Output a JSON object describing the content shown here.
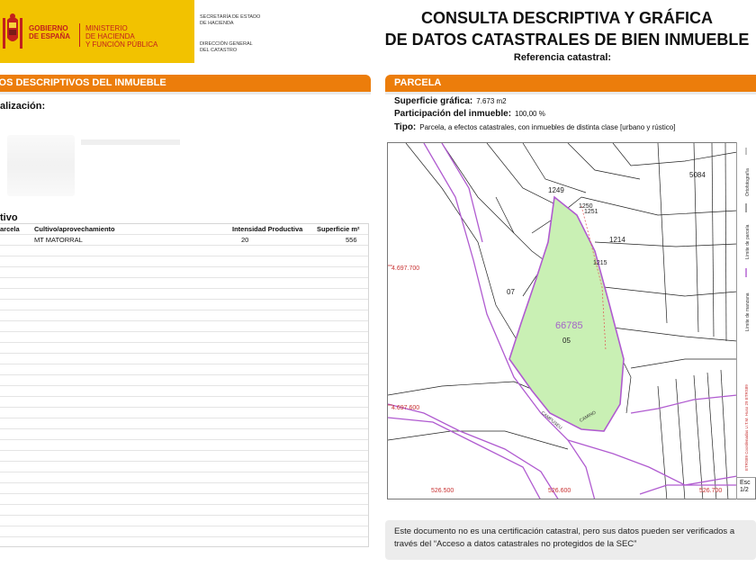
{
  "header": {
    "gobierno": [
      "GOBIERNO",
      "DE ESPAÑA"
    ],
    "ministerio": [
      "MINISTERIO",
      "DE HACIENDA",
      "Y FUNCIÓN PÚBLICA"
    ],
    "secretaria": [
      "SECRETARÍA DE ESTADO",
      "DE HACIENDA"
    ],
    "direccion": [
      "DIRECCIÓN GENERAL",
      "DEL CATASTRO"
    ],
    "title_line1": "CONSULTA DESCRIPTIVA Y GRÁFICA",
    "title_line2": "DE DATOS CATASTRALES DE BIEN INMUEBLE",
    "referencia_label": "Referencia catastral:"
  },
  "left": {
    "section_title": "TOS DESCRIPTIVOS DEL INMUEBLE",
    "localizacion_label": "alización:",
    "cultivo_label": "tivo",
    "table": {
      "headers": [
        "arcela",
        "Cultivo/aprovechamiento",
        "Intensidad Productiva",
        "Superficie m²"
      ],
      "rows": [
        {
          "cultivo": "MT MATORRAL",
          "intensidad": "20",
          "superficie": "556"
        }
      ]
    }
  },
  "right": {
    "section_title": "PARCELA",
    "superficie_label": "Superficie gráfica:",
    "superficie_value": "7.673 m2",
    "participacion_label": "Participación del inmueble:",
    "participacion_value": "100,00 %",
    "tipo_label": "Tipo:",
    "tipo_value": "Parcela, a efectos catastrales, con inmuebles de distinta clase [urbano y rústico]",
    "map_labels": {
      "parcel_number": "66785",
      "sub_label": "05",
      "n1249": "1249",
      "n1250": "1250",
      "n1251": "1251",
      "n1214": "1214",
      "n1215": "1215",
      "n5084": "5084",
      "n07": "07",
      "coord_y1": "4.697.700",
      "coord_y2": "4.697.600",
      "coord_x1": "526.500",
      "coord_x2": "526.600",
      "coord_x3": "526.700",
      "road1": "CAMPUSEU",
      "road2": "CAMINO"
    },
    "legend": {
      "ortofoto": "Ortofotografía",
      "limite_parcela": "Límite de parcela",
      "limite_manzana": "Límite de manzana",
      "coordenadas": "ETRS89 Coordenadas U.T.M. Huso 29 ETRS89"
    },
    "scale_label": "Esc",
    "scale_value": "1/2",
    "note": "Este documento no es una certificación catastral, pero sus datos pueden ser verificados a través del “Acceso a datos catastrales no protegidos de la SEC”"
  },
  "colors": {
    "orange": "#ec7d0b",
    "logo_yellow": "#f2c200",
    "parcel_fill": "#c9f0b4",
    "boundary_purple": "#b05bd0"
  }
}
